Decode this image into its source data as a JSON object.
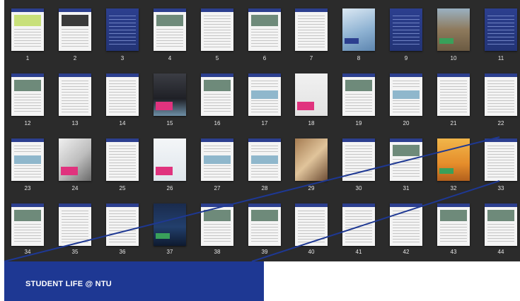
{
  "pages": [
    {
      "number": "1",
      "style": "cover-white"
    },
    {
      "number": "2",
      "style": "portrait"
    },
    {
      "number": "3",
      "style": "dark-blue"
    },
    {
      "number": "4",
      "style": "photo-grid"
    },
    {
      "number": "5",
      "style": "text"
    },
    {
      "number": "6",
      "style": "photo-grid"
    },
    {
      "number": "7",
      "style": "text"
    },
    {
      "number": "8",
      "style": "sky-photo"
    },
    {
      "number": "9",
      "style": "dark-blue"
    },
    {
      "number": "10",
      "style": "building-photo"
    },
    {
      "number": "11",
      "style": "dark-blue"
    },
    {
      "number": "12",
      "style": "text-photo"
    },
    {
      "number": "13",
      "style": "text"
    },
    {
      "number": "14",
      "style": "text"
    },
    {
      "number": "15",
      "style": "passport-photo"
    },
    {
      "number": "16",
      "style": "text-photo"
    },
    {
      "number": "17",
      "style": "text-table"
    },
    {
      "number": "18",
      "style": "mannequin-photo"
    },
    {
      "number": "19",
      "style": "text-photo"
    },
    {
      "number": "20",
      "style": "text-table"
    },
    {
      "number": "21",
      "style": "text"
    },
    {
      "number": "22",
      "style": "text"
    },
    {
      "number": "23",
      "style": "text-table"
    },
    {
      "number": "24",
      "style": "phone-photo"
    },
    {
      "number": "25",
      "style": "text"
    },
    {
      "number": "26",
      "style": "planner-photo"
    },
    {
      "number": "27",
      "style": "text-table"
    },
    {
      "number": "28",
      "style": "text-table"
    },
    {
      "number": "29",
      "style": "students-photo"
    },
    {
      "number": "30",
      "style": "text"
    },
    {
      "number": "31",
      "style": "photo-grid"
    },
    {
      "number": "32",
      "style": "sports-photo"
    },
    {
      "number": "33",
      "style": "text"
    },
    {
      "number": "34",
      "style": "photo-grid"
    },
    {
      "number": "35",
      "style": "text"
    },
    {
      "number": "36",
      "style": "text"
    },
    {
      "number": "37",
      "style": "night-photo"
    },
    {
      "number": "38",
      "style": "photo-grid"
    },
    {
      "number": "39",
      "style": "text-photo"
    },
    {
      "number": "40",
      "style": "text"
    },
    {
      "number": "41",
      "style": "text"
    },
    {
      "number": "42",
      "style": "text"
    },
    {
      "number": "43",
      "style": "text-photo"
    },
    {
      "number": "44",
      "style": "text-photo"
    }
  ],
  "banner": {
    "title": "STUDENT LIFE @ NTU"
  },
  "colors": {
    "viewer_bg": "#2b2b2b",
    "banner": "#1e3893",
    "page_header": "#2c3f8f",
    "page_numbers": "#e6e6e6"
  }
}
